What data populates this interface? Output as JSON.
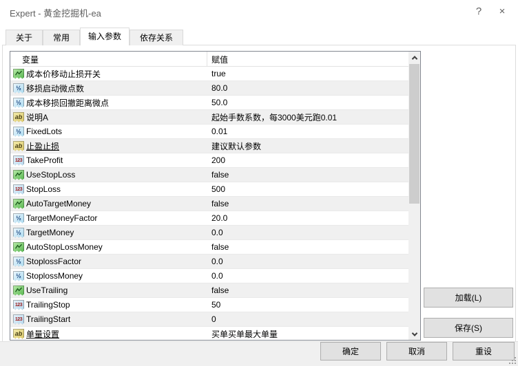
{
  "window": {
    "title": "Expert - 黄金挖掘机-ea",
    "help_glyph": "?",
    "close_glyph": "×"
  },
  "tabs": [
    {
      "id": "about",
      "label": "关于",
      "active": false
    },
    {
      "id": "common",
      "label": "常用",
      "active": false
    },
    {
      "id": "inputs",
      "label": "输入参数",
      "active": true
    },
    {
      "id": "dependencies",
      "label": "依存关系",
      "active": false
    }
  ],
  "table": {
    "columns": [
      "变量",
      "赋值"
    ],
    "rows": [
      {
        "type": "bool",
        "name": "成本价移动止损开关",
        "value": "true",
        "underline": false
      },
      {
        "type": "double",
        "name": "移损启动微点数",
        "value": "80.0",
        "underline": false
      },
      {
        "type": "double",
        "name": "成本移损回撤距离微点",
        "value": "50.0",
        "underline": false
      },
      {
        "type": "string",
        "name": "说明A",
        "value": "起始手数系数，每3000美元跑0.01",
        "underline": false
      },
      {
        "type": "double",
        "name": "FixedLots",
        "value": "0.01",
        "underline": false
      },
      {
        "type": "string",
        "name": "止盈止损",
        "value": "建议默认参数",
        "underline": true
      },
      {
        "type": "int",
        "name": "TakeProfit",
        "value": "200",
        "underline": false
      },
      {
        "type": "bool",
        "name": "UseStopLoss",
        "value": "false",
        "underline": false
      },
      {
        "type": "int",
        "name": "StopLoss",
        "value": "500",
        "underline": false
      },
      {
        "type": "bool",
        "name": "AutoTargetMoney",
        "value": "false",
        "underline": false
      },
      {
        "type": "double",
        "name": "TargetMoneyFactor",
        "value": "20.0",
        "underline": false
      },
      {
        "type": "double",
        "name": "TargetMoney",
        "value": "0.0",
        "underline": false
      },
      {
        "type": "bool",
        "name": "AutoStopLossMoney",
        "value": "false",
        "underline": false
      },
      {
        "type": "double",
        "name": "StoplossFactor",
        "value": "0.0",
        "underline": false
      },
      {
        "type": "double",
        "name": "StoplossMoney",
        "value": "0.0",
        "underline": false
      },
      {
        "type": "bool",
        "name": "UseTrailing",
        "value": "false",
        "underline": false
      },
      {
        "type": "int",
        "name": "TrailingStop",
        "value": "50",
        "underline": false
      },
      {
        "type": "int",
        "name": "TrailingStart",
        "value": "0",
        "underline": false
      },
      {
        "type": "string",
        "name": "单量设置",
        "value": "买单买单最大单量",
        "underline": true
      }
    ]
  },
  "icon_glyphs": {
    "bool": "zigzag-chart",
    "double": "½",
    "int": "123",
    "string": "ab"
  },
  "buttons": {
    "load": "加载(L)",
    "save": "保存(S)",
    "ok": "确定",
    "cancel": "取消",
    "reset": "重设"
  },
  "colors": {
    "alt_row": "#f0f0f0",
    "button_face": "#e1e1e1",
    "bool_icon_green": "#54b44c",
    "numeric_icon_blue": "#a9d9ef",
    "string_icon_yellow": "#dbc868",
    "scroll_thumb": "#cdcdcd"
  }
}
